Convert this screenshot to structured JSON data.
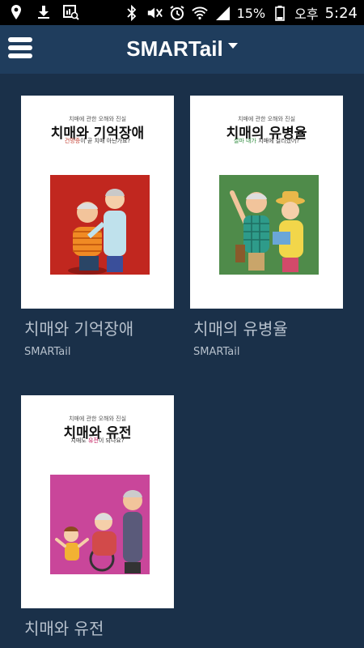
{
  "status_bar": {
    "battery": "15%",
    "ampm": "오후",
    "time": "5:24"
  },
  "app_bar": {
    "title": "SMARTail"
  },
  "books": [
    {
      "title": "치매와 기억장애",
      "author": "SMARTail",
      "cover": {
        "kicker": "치매에 관한 오해와 진실",
        "title": "치매와 기억장애",
        "subtitle_highlight": "건망증",
        "subtitle_rest": "이 곧 치매 아닌가요?",
        "highlight_color": "#c0392b",
        "art_color": "#c1271f"
      }
    },
    {
      "title": "치매의 유병율",
      "author": "SMARTail",
      "cover": {
        "kicker": "치매에 관한 오해와 진실",
        "title": "치매의 유병율",
        "subtitle_highlight": "설마 내가",
        "subtitle_rest": " 치매에 걸리겠어?",
        "highlight_color": "#2e8b3e",
        "art_color": "#4f8b4a"
      }
    },
    {
      "title": "치매와 유전",
      "author": "",
      "cover": {
        "kicker": "치매에 관한 오해와 진실",
        "title": "치매와 유전",
        "subtitle_pre": "치매도 ",
        "subtitle_highlight": "유전",
        "subtitle_rest": "이 되나요?",
        "highlight_color": "#c2185b",
        "art_color": "#c9469a"
      }
    }
  ]
}
